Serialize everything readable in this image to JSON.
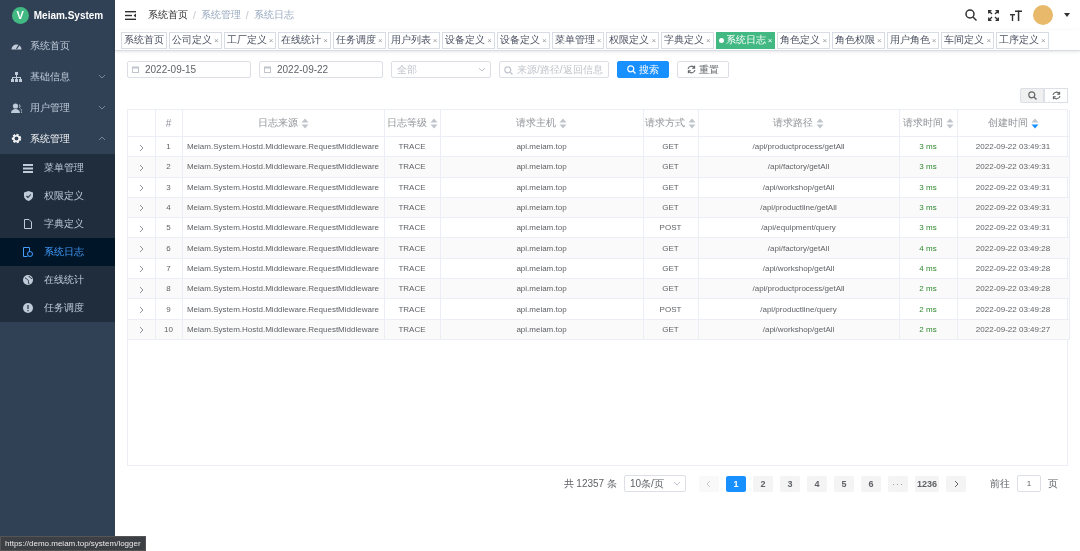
{
  "sidebar": {
    "logo": {
      "mark": "V",
      "title": "Meiam.System"
    },
    "items": [
      {
        "label": "系统首页",
        "kind": "link",
        "selected": false
      },
      {
        "label": "基础信息",
        "kind": "group",
        "expanded": false,
        "selected": false
      },
      {
        "label": "用户管理",
        "kind": "group",
        "expanded": false,
        "selected": false
      },
      {
        "label": "系统管理",
        "kind": "group",
        "expanded": true,
        "selected": false,
        "children": [
          {
            "label": "菜单管理",
            "selected": false
          },
          {
            "label": "权限定义",
            "selected": false
          },
          {
            "label": "字典定义",
            "selected": false
          },
          {
            "label": "系统日志",
            "selected": true
          },
          {
            "label": "在线统计",
            "selected": false
          },
          {
            "label": "任务调度",
            "selected": false
          }
        ]
      }
    ]
  },
  "breadcrumb": {
    "separator": "/",
    "items": [
      "系统首页",
      "系统管理",
      "系统日志"
    ]
  },
  "tags": [
    {
      "label": "系统首页",
      "selected": false
    },
    {
      "label": "公司定义",
      "selected": false,
      "close": "×"
    },
    {
      "label": "工厂定义",
      "selected": false,
      "close": "×"
    },
    {
      "label": "在线统计",
      "selected": false,
      "close": "×"
    },
    {
      "label": "任务调度",
      "selected": false,
      "close": "×"
    },
    {
      "label": "用户列表",
      "selected": false,
      "close": "×"
    },
    {
      "label": "设备定义",
      "selected": false,
      "close": "×"
    },
    {
      "label": "设备定义",
      "selected": false,
      "close": "×"
    },
    {
      "label": "菜单管理",
      "selected": false,
      "close": "×"
    },
    {
      "label": "权限定义",
      "selected": false,
      "close": "×"
    },
    {
      "label": "字典定义",
      "selected": false,
      "close": "×"
    },
    {
      "label": "系统日志",
      "selected": true,
      "close": "×"
    },
    {
      "label": "角色定义",
      "selected": false,
      "close": "×"
    },
    {
      "label": "角色权限",
      "selected": false,
      "close": "×"
    },
    {
      "label": "用户角色",
      "selected": false,
      "close": "×"
    },
    {
      "label": "车间定义",
      "selected": false,
      "close": "×"
    },
    {
      "label": "工序定义",
      "selected": false,
      "close": "×"
    }
  ],
  "filters": {
    "start_date": "2022-09-15",
    "end_date": "2022-09-22",
    "level": {
      "placeholder": "全部"
    },
    "search": {
      "placeholder": "来源/路径/返回信息"
    },
    "buttons": [
      {
        "label": "搜索",
        "kind": "primary"
      },
      {
        "label": "重置",
        "kind": "reset"
      }
    ]
  },
  "table": {
    "columns": [
      {
        "label": "#",
        "sortable": false,
        "sorted_descending": false
      },
      {
        "label": "日志来源",
        "sortable": true,
        "sorted_descending": false
      },
      {
        "label": "日志等级",
        "sortable": true,
        "sorted_descending": false
      },
      {
        "label": "请求主机",
        "sortable": true,
        "sorted_descending": false
      },
      {
        "label": "请求方式",
        "sortable": true,
        "sorted_descending": false
      },
      {
        "label": "请求路径",
        "sortable": true,
        "sorted_descending": false
      },
      {
        "label": "请求时间",
        "sortable": true,
        "sorted_descending": false
      },
      {
        "label": "创建时间",
        "sortable": true,
        "sorted_descending": true
      }
    ],
    "rows": [
      [
        "1",
        "Meiam.System.Hostd.Middleware.RequestMiddleware",
        "TRACE",
        "api.meiam.top",
        "GET",
        "/api/productprocess/getAll",
        "3 ms",
        "2022-09-22 03:49:31"
      ],
      [
        "2",
        "Meiam.System.Hostd.Middleware.RequestMiddleware",
        "TRACE",
        "api.meiam.top",
        "GET",
        "/api/factory/getAll",
        "3 ms",
        "2022-09-22 03:49:31"
      ],
      [
        "3",
        "Meiam.System.Hostd.Middleware.RequestMiddleware",
        "TRACE",
        "api.meiam.top",
        "GET",
        "/api/workshop/getAll",
        "3 ms",
        "2022-09-22 03:49:31"
      ],
      [
        "4",
        "Meiam.System.Hostd.Middleware.RequestMiddleware",
        "TRACE",
        "api.meiam.top",
        "GET",
        "/api/productline/getAll",
        "3 ms",
        "2022-09-22 03:49:31"
      ],
      [
        "5",
        "Meiam.System.Hostd.Middleware.RequestMiddleware",
        "TRACE",
        "api.meiam.top",
        "POST",
        "/api/equipment/query",
        "3 ms",
        "2022-09-22 03:49:31"
      ],
      [
        "6",
        "Meiam.System.Hostd.Middleware.RequestMiddleware",
        "TRACE",
        "api.meiam.top",
        "GET",
        "/api/factory/getAll",
        "4 ms",
        "2022-09-22 03:49:28"
      ],
      [
        "7",
        "Meiam.System.Hostd.Middleware.RequestMiddleware",
        "TRACE",
        "api.meiam.top",
        "GET",
        "/api/workshop/getAll",
        "4 ms",
        "2022-09-22 03:49:28"
      ],
      [
        "8",
        "Meiam.System.Hostd.Middleware.RequestMiddleware",
        "TRACE",
        "api.meiam.top",
        "GET",
        "/api/productprocess/getAll",
        "2 ms",
        "2022-09-22 03:49:28"
      ],
      [
        "9",
        "Meiam.System.Hostd.Middleware.RequestMiddleware",
        "TRACE",
        "api.meiam.top",
        "POST",
        "/api/productline/query",
        "2 ms",
        "2022-09-22 03:49:28"
      ],
      [
        "10",
        "Meiam.System.Hostd.Middleware.RequestMiddleware",
        "TRACE",
        "api.meiam.top",
        "GET",
        "/api/workshop/getAll",
        "2 ms",
        "2022-09-22 03:49:27"
      ]
    ]
  },
  "pagination": {
    "total": "共 12357 条",
    "page_size": "10条/页",
    "pages": [
      {
        "label": "1",
        "kind": "page",
        "selected": true
      },
      {
        "label": "2",
        "kind": "page",
        "selected": false
      },
      {
        "label": "3",
        "kind": "page",
        "selected": false
      },
      {
        "label": "4",
        "kind": "page",
        "selected": false
      },
      {
        "label": "5",
        "kind": "page",
        "selected": false
      },
      {
        "label": "6",
        "kind": "page",
        "selected": false
      },
      {
        "label": "···",
        "kind": "more",
        "selected": false
      },
      {
        "label": "1236",
        "kind": "page",
        "selected": false
      }
    ],
    "prev_disabled": true,
    "goto_label": "前往",
    "goto_value": "1",
    "goto_unit": "页"
  },
  "status_url": "https://demo.meiam.top/system/logger"
}
